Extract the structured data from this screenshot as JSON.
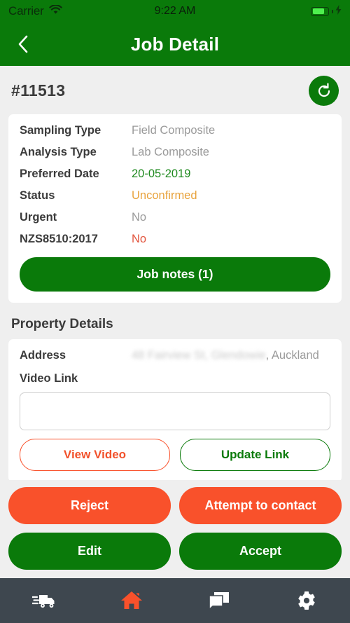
{
  "status_bar": {
    "carrier": "Carrier",
    "time": "9:22 AM",
    "wifi_icon": "wifi-icon",
    "battery_icon": "battery-charging-icon"
  },
  "nav": {
    "back_icon": "chevron-left-icon",
    "title": "Job Detail"
  },
  "job": {
    "id": "#11513",
    "refresh_icon": "refresh-icon",
    "details": [
      {
        "label": "Sampling Type",
        "value": "Field Composite",
        "style": "v-plain"
      },
      {
        "label": "Analysis Type",
        "value": "Lab Composite",
        "style": "v-plain"
      },
      {
        "label": "Preferred Date",
        "value": "20-05-2019",
        "style": "v-green"
      },
      {
        "label": "Status",
        "value": "Unconfirmed",
        "style": "v-amber"
      },
      {
        "label": "Urgent",
        "value": "No",
        "style": "v-plain"
      },
      {
        "label": "NZS8510:2017",
        "value": "No",
        "style": "v-red"
      }
    ],
    "notes_button": "Job notes (1)"
  },
  "property": {
    "section_title": "Property Details",
    "address_label": "Address",
    "address_value": "48 Fairview St, Glendowie",
    "address_suffix": ", Auckland",
    "video_link_label": "Video Link",
    "video_link_value": "",
    "video_link_placeholder": "",
    "view_video_button": "View Video",
    "update_link_button": "Update Link"
  },
  "actions": {
    "reject": "Reject",
    "attempt_contact": "Attempt to contact",
    "edit": "Edit",
    "accept": "Accept"
  },
  "tabbar": {
    "items": [
      {
        "icon": "truck-icon",
        "active": false
      },
      {
        "icon": "home-icon",
        "active": true
      },
      {
        "icon": "chat-icon",
        "active": false
      },
      {
        "icon": "settings-icon",
        "active": false
      }
    ],
    "active_color": "#f9512b",
    "inactive_color": "#ffffff"
  },
  "colors": {
    "brand_green": "#0a7a0a",
    "accent_orange": "#f9512b",
    "amber": "#e8a33d",
    "red": "#e2553e",
    "tabbar_bg": "#3e474f",
    "page_bg": "#efefef"
  }
}
